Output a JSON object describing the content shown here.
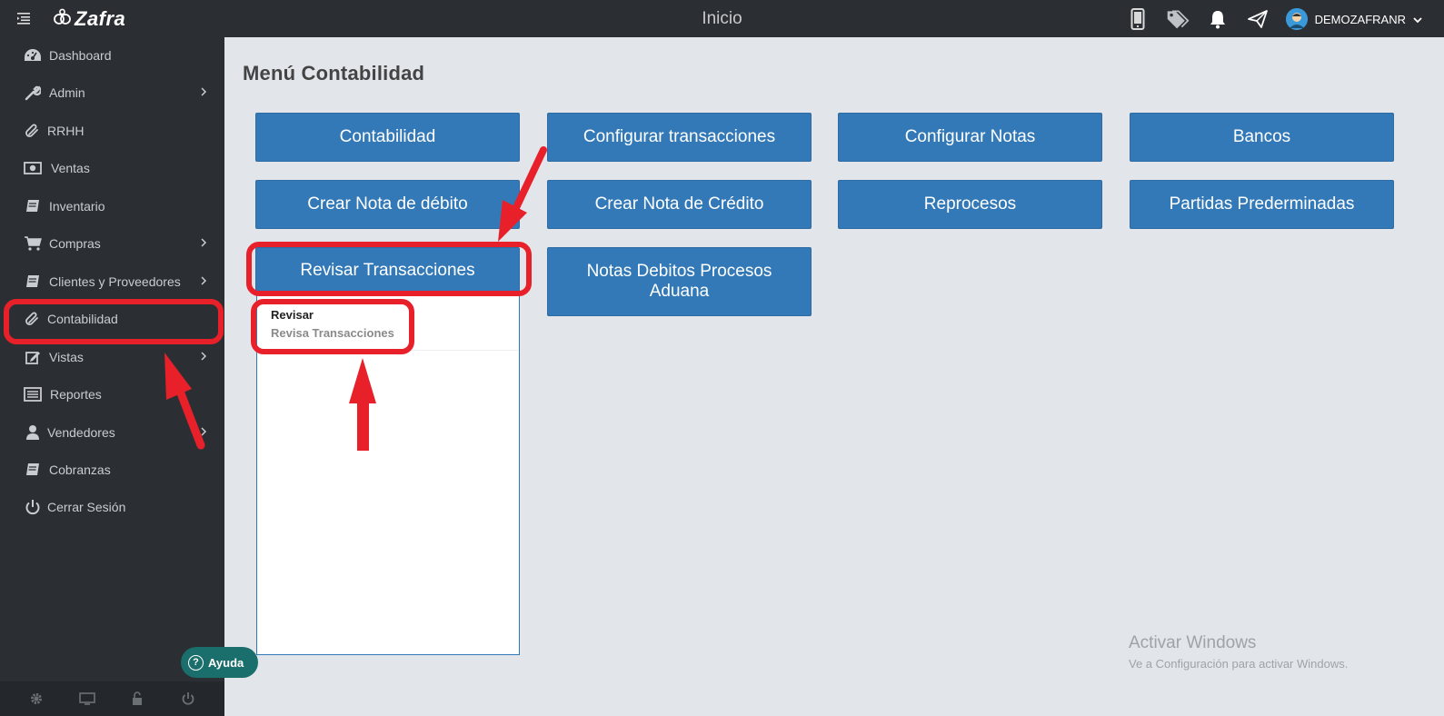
{
  "topbar": {
    "logo": "Zafra",
    "title": "Inicio",
    "username": "DEMOZAFRANR",
    "icons": [
      "mobile-icon",
      "tags-icon",
      "bell-icon",
      "paper-plane-icon"
    ]
  },
  "sidebar": {
    "items": [
      {
        "label": "Dashboard",
        "icon": "dashboard-icon",
        "has_submenu": false
      },
      {
        "label": "Admin",
        "icon": "wrench-icon",
        "has_submenu": true
      },
      {
        "label": "RRHH",
        "icon": "paperclip-icon",
        "has_submenu": false
      },
      {
        "label": "Ventas",
        "icon": "money-icon",
        "has_submenu": false
      },
      {
        "label": "Inventario",
        "icon": "book-icon",
        "has_submenu": false
      },
      {
        "label": "Compras",
        "icon": "cart-icon",
        "has_submenu": true
      },
      {
        "label": "Clientes y Proveedores",
        "icon": "book-icon",
        "has_submenu": true
      },
      {
        "label": "Contabilidad",
        "icon": "paperclip-icon",
        "has_submenu": false
      },
      {
        "label": "Vistas",
        "icon": "edit-icon",
        "has_submenu": true
      },
      {
        "label": "Reportes",
        "icon": "list-icon",
        "has_submenu": false
      },
      {
        "label": "Vendedores",
        "icon": "user-icon",
        "has_submenu": true
      },
      {
        "label": "Cobranzas",
        "icon": "book-icon",
        "has_submenu": false
      },
      {
        "label": "Cerrar Sesión",
        "icon": "power-icon",
        "has_submenu": false
      }
    ],
    "footer_icons": [
      "gear-icon",
      "screen-icon",
      "lock-icon",
      "power-icon"
    ]
  },
  "help": {
    "label": "Ayuda"
  },
  "main": {
    "title": "Menú Contabilidad",
    "buttons": [
      "Contabilidad",
      "Configurar transacciones",
      "Configurar Notas",
      "Bancos",
      "Crear Nota de débito",
      "Crear Nota de Crédito",
      "Reprocesos",
      "Partidas Prederminadas",
      "Revisar Transacciones",
      "Notas Debitos Procesos Aduana"
    ],
    "dropdown": {
      "title": "Revisar",
      "subtitle": "Revisa Transacciones"
    }
  },
  "watermark": {
    "line1": "Activar Windows",
    "line2": "Ve a Configuración para activar Windows."
  },
  "colors": {
    "accent": "#3379b8",
    "sidebar": "#2b2f33",
    "annotation": "#e8202a",
    "help": "#1a6e6b"
  }
}
